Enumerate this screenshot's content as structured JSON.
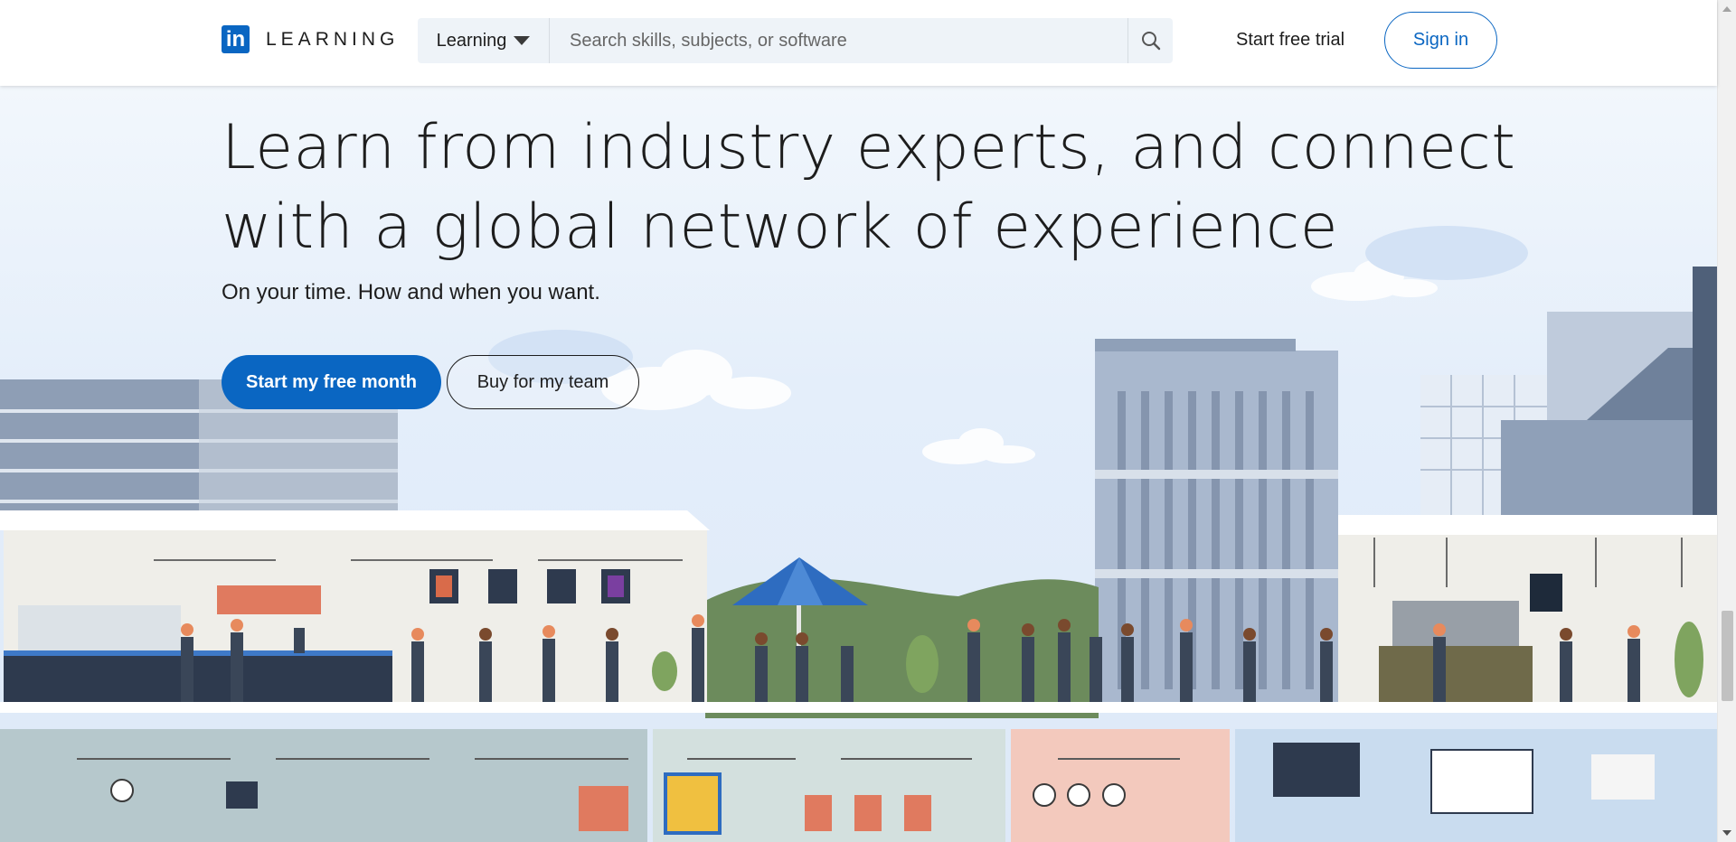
{
  "header": {
    "logo_mark": "in",
    "logo_word": "LEARNING",
    "search_category": "Learning",
    "search_placeholder": "Search skills, subjects, or software",
    "start_trial": "Start free trial",
    "sign_in": "Sign in"
  },
  "hero": {
    "title": "Learn from industry experts, and connect with a global network of experience",
    "subtitle": "On your time. How and when you want.",
    "cta_primary": "Start my free month",
    "cta_secondary": "Buy for my team"
  },
  "colors": {
    "brand": "#0a66c2",
    "text": "#1d1d1d",
    "search_bg": "#eef3f8"
  },
  "icons": {
    "logo": "linkedin-logo-icon",
    "dropdown": "caret-down-icon",
    "search": "search-icon"
  }
}
